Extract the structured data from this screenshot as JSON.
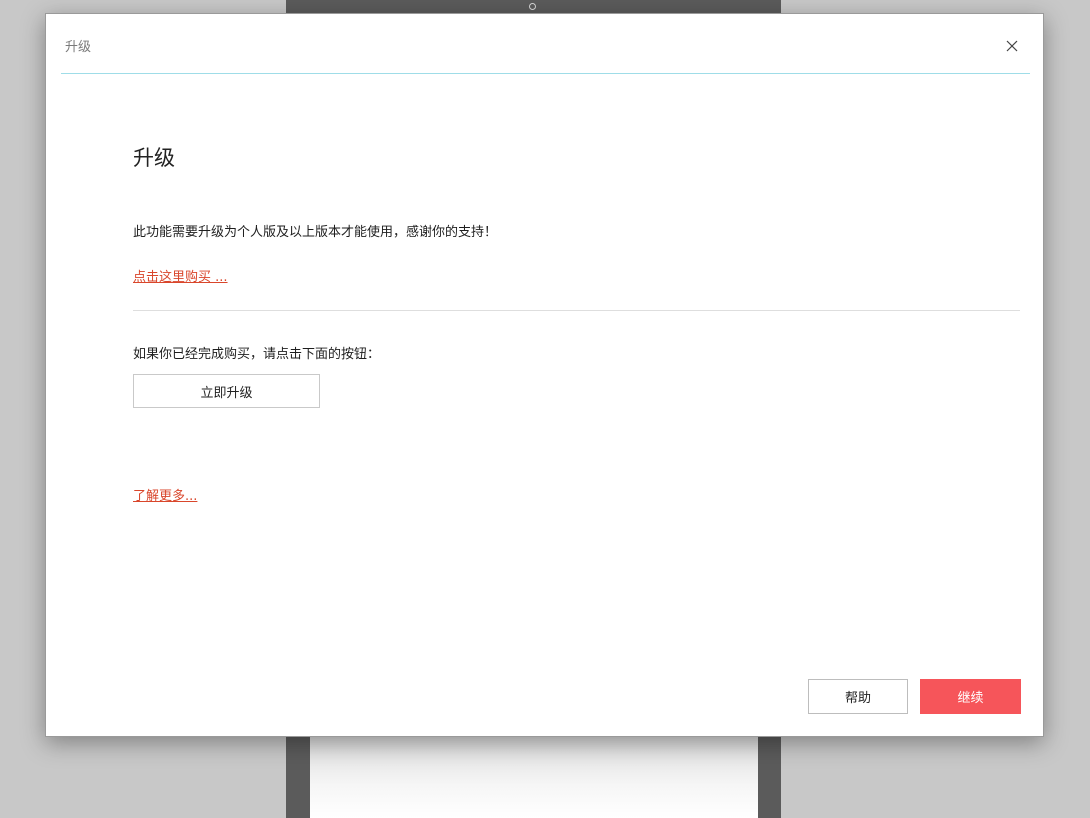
{
  "dialog": {
    "title": "升级",
    "close_icon": "close-icon"
  },
  "main": {
    "heading": "升级",
    "description": "此功能需要升级为个人版及以上版本才能使用，感谢你的支持！",
    "buy_link": "点击这里购买 ...",
    "purchased_text": "如果你已经完成购买，请点击下面的按钮：",
    "upgrade_button": "立即升级",
    "learn_more_link": "了解更多..."
  },
  "footer": {
    "help_button": "帮助",
    "continue_button": "继续"
  },
  "colors": {
    "accent": "#f6555a",
    "link": "#d9462b",
    "title_rule": "#9fdde8"
  }
}
